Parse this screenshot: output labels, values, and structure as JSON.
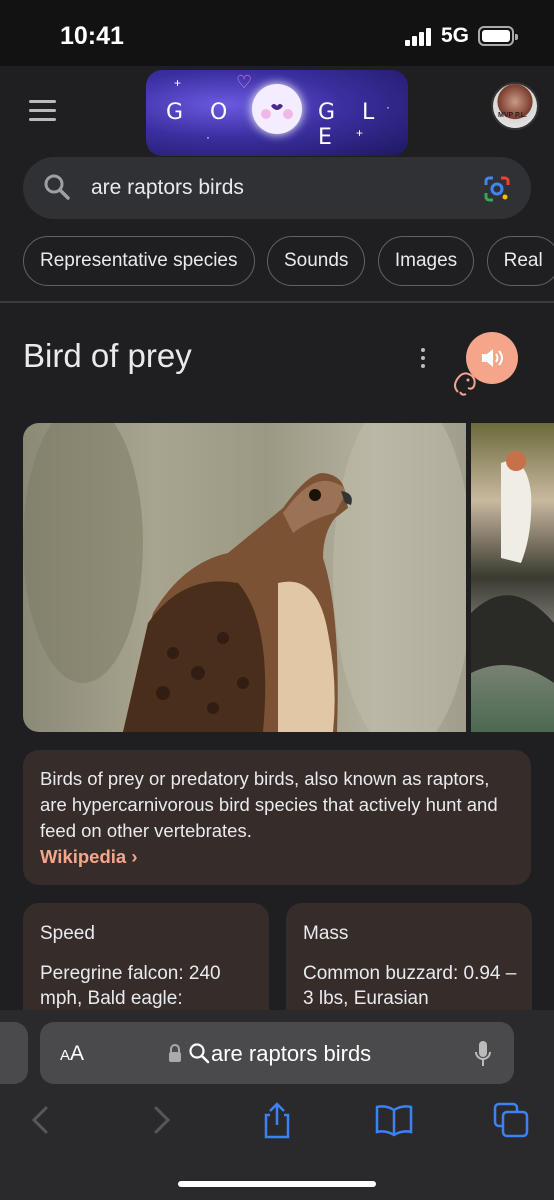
{
  "status": {
    "time": "10:41",
    "network": "5G",
    "signal_bars": 4,
    "battery_level": 1.0
  },
  "header": {
    "menu_icon": "hamburger-menu-icon",
    "doodle_text": "GO GLE",
    "avatar_text": "MVP P.L."
  },
  "search": {
    "query": "are raptors birds",
    "search_icon": "search-icon",
    "lens_icon": "google-lens-icon"
  },
  "chips": [
    {
      "label": "Representative species"
    },
    {
      "label": "Sounds"
    },
    {
      "label": "Images"
    },
    {
      "label": "Real"
    }
  ],
  "knowledge_panel": {
    "title": "Bird of prey",
    "more_icon": "more-vert-icon",
    "speaker_icon": "speaker-icon",
    "description": "Birds of prey or predatory birds, also known as raptors, are hypercarnivorous bird species that actively hunt and feed on other vertebrates.",
    "source_link": "Wikipedia",
    "source_chevron": "›",
    "facts": [
      {
        "title": "Speed",
        "body": "Peregrine falcon: 240 mph, Bald eagle:"
      },
      {
        "title": "Mass",
        "body": "Common buzzard: 0.94 – 3 lbs, Eurasian"
      }
    ]
  },
  "safari": {
    "text_size_label": "AA",
    "url_text": "are raptors birds",
    "icons": [
      "back-icon",
      "forward-icon",
      "share-icon",
      "bookmarks-icon",
      "tabs-icon"
    ]
  },
  "colors": {
    "background": "#1f1f21",
    "accent": "#f4a58a",
    "card": "#362d2b",
    "chip_border": "#5f6368",
    "safari_blue": "#3b82f6"
  }
}
